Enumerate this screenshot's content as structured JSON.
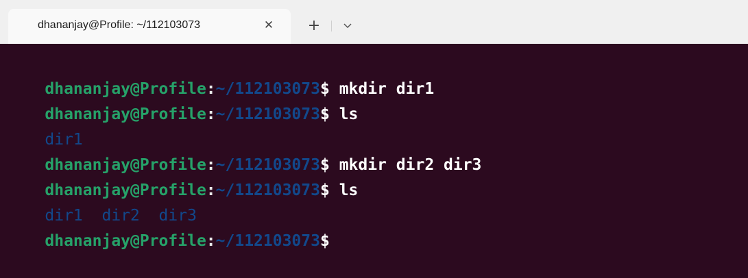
{
  "window": {
    "tab_title": "dhananjay@Profile: ~/112103073",
    "close_icon": "close-icon",
    "new_tab_label": "+",
    "dropdown_icon": "chevron-down-icon"
  },
  "colors": {
    "background": "#2c0a1f",
    "prompt_user": "#26a269",
    "prompt_path": "#12488b",
    "directory_output": "#12488b",
    "command_text": "#ffffff"
  },
  "terminal": {
    "lines": [
      {
        "user": "dhananjay@Profile",
        "colon": ":",
        "path": "~/112103073",
        "dollar": "$",
        "cmd": " mkdir dir1"
      },
      {
        "user": "dhananjay@Profile",
        "colon": ":",
        "path": "~/112103073",
        "dollar": "$",
        "cmd": " ls"
      },
      {
        "output": "dir1"
      },
      {
        "user": "dhananjay@Profile",
        "colon": ":",
        "path": "~/112103073",
        "dollar": "$",
        "cmd": " mkdir dir2 dir3"
      },
      {
        "user": "dhananjay@Profile",
        "colon": ":",
        "path": "~/112103073",
        "dollar": "$",
        "cmd": " ls"
      },
      {
        "output": "dir1  dir2  dir3"
      },
      {
        "user": "dhananjay@Profile",
        "colon": ":",
        "path": "~/112103073",
        "dollar": "$",
        "cmd": ""
      }
    ]
  }
}
